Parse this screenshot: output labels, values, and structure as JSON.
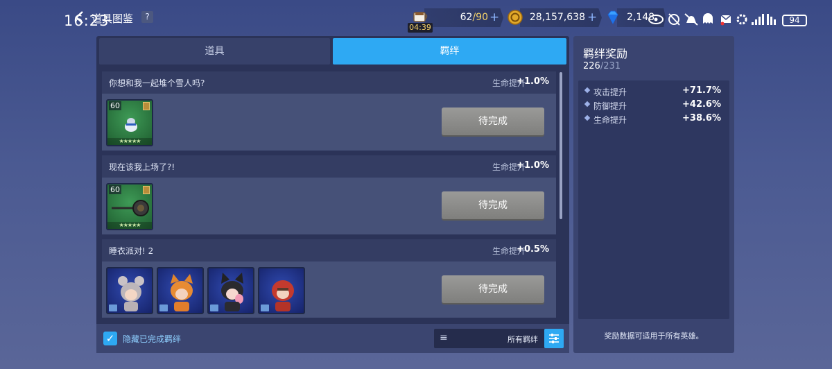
{
  "status_bar": {
    "time": "16:23",
    "battery": "94"
  },
  "header": {
    "title": "道具图鉴",
    "help_label": "?"
  },
  "resources": {
    "stamina": {
      "current": "62",
      "max": "/90",
      "plus": "+",
      "timer": "04:39"
    },
    "gold": {
      "value": "28,157,638",
      "plus": "+"
    },
    "gems": {
      "value": "2,148"
    }
  },
  "tabs": [
    {
      "label": "道具",
      "active": false
    },
    {
      "label": "羁绊",
      "active": true
    }
  ],
  "bond_cards": [
    {
      "name": "你想和我一起堆个雪人吗?",
      "stat": "生命提升",
      "value": "+1.0%",
      "button": "待完成",
      "items": [
        {
          "level": "60",
          "stars": "★★★★★"
        }
      ]
    },
    {
      "name": "现在该我上场了?!",
      "stat": "生命提升",
      "value": "+1.0%",
      "button": "待完成",
      "items": [
        {
          "level": "60",
          "stars": "★★★★★"
        }
      ]
    },
    {
      "name": "睡衣派对! 2",
      "stat": "生命提升",
      "value": "+0.5%",
      "button": "待完成",
      "heroes": 4
    }
  ],
  "footer": {
    "hide_completed_label": "隐藏已完成羁绊",
    "hide_completed_checked": true,
    "filter_label": "所有羁绊"
  },
  "side_panel": {
    "title": "羁绊奖励",
    "count_current": "226",
    "count_total": "/231",
    "bonuses": [
      {
        "name": "攻击提升",
        "value": "+71.7%"
      },
      {
        "name": "防御提升",
        "value": "+42.6%"
      },
      {
        "name": "生命提升",
        "value": "+38.6%"
      }
    ],
    "note": "奖励数据可适用于所有英雄。"
  },
  "colors": {
    "accent": "#2ea9f3",
    "panel": "#2b3358",
    "button_gray": "#8d8d8b",
    "timer_text": "#f8d36a"
  }
}
